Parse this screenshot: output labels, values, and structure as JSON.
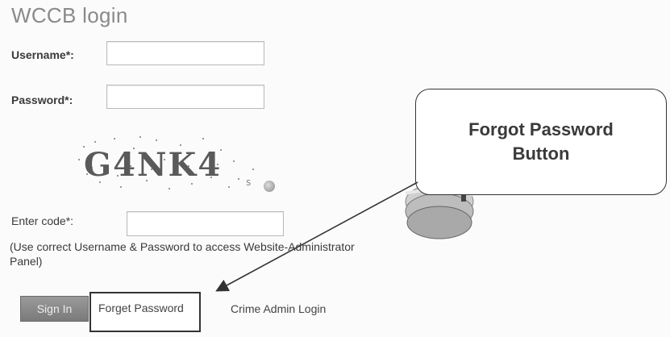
{
  "page": {
    "title": "WCCB login"
  },
  "form": {
    "username_label": "Username*:",
    "password_label": "Password*:",
    "enter_code_label": "Enter code*:",
    "captcha_text": "G4NK4",
    "captcha_small": "s",
    "note": "(Use correct Username & Password to access Website-Administrator Panel)",
    "signin_label": "Sign In",
    "forget_password_label": "Forget Password",
    "crime_admin_label": "Crime Admin Login"
  },
  "callout": {
    "line1": "Forgot Password",
    "line2": "Button"
  }
}
